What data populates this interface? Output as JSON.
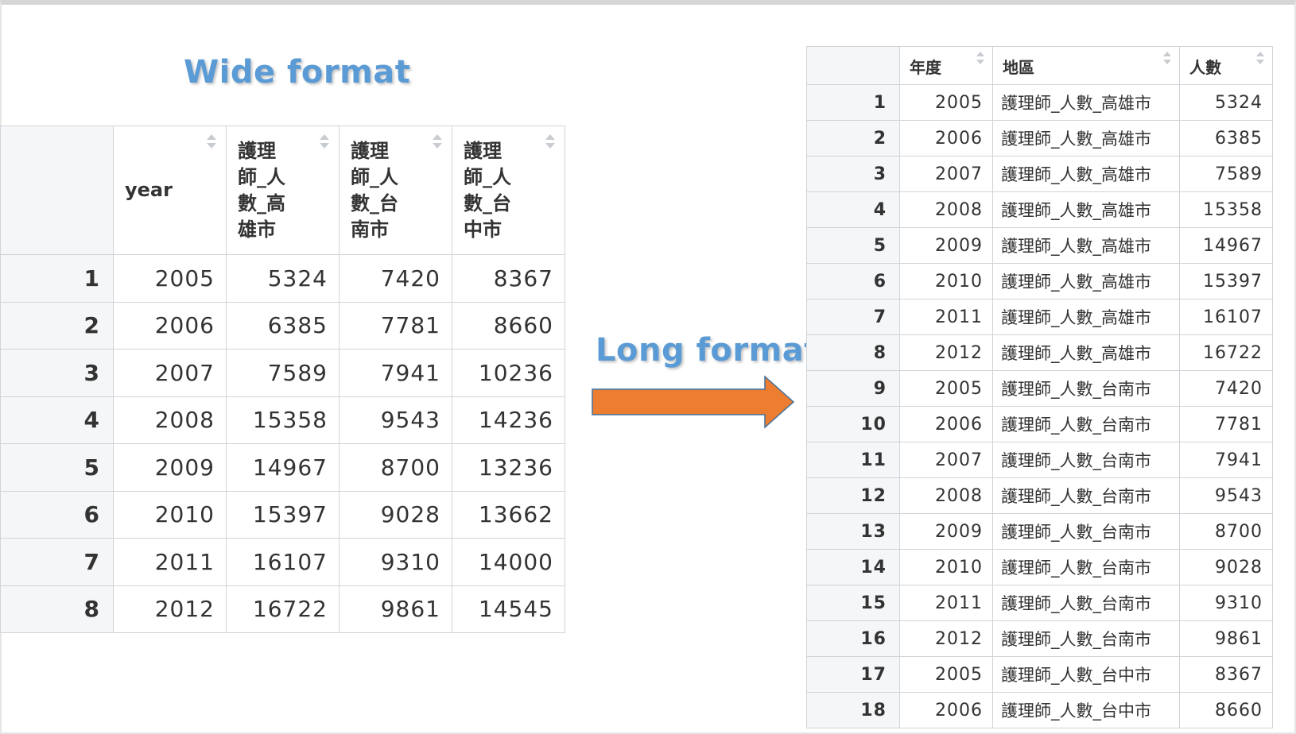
{
  "wide": {
    "title": "Wide format",
    "headers": [
      "year",
      "護理\n師_人\n數_高\n雄市",
      "護理\n師_人\n數_台\n南市",
      "護理\n師_人\n數_台\n中市"
    ],
    "rows": [
      {
        "index": "1",
        "values": [
          "2005",
          "5324",
          "7420",
          "8367"
        ]
      },
      {
        "index": "2",
        "values": [
          "2006",
          "6385",
          "7781",
          "8660"
        ]
      },
      {
        "index": "3",
        "values": [
          "2007",
          "7589",
          "7941",
          "10236"
        ]
      },
      {
        "index": "4",
        "values": [
          "2008",
          "15358",
          "9543",
          "14236"
        ]
      },
      {
        "index": "5",
        "values": [
          "2009",
          "14967",
          "8700",
          "13236"
        ]
      },
      {
        "index": "6",
        "values": [
          "2010",
          "15397",
          "9028",
          "13662"
        ]
      },
      {
        "index": "7",
        "values": [
          "2011",
          "16107",
          "9310",
          "14000"
        ]
      },
      {
        "index": "8",
        "values": [
          "2012",
          "16722",
          "9861",
          "14545"
        ]
      }
    ]
  },
  "long": {
    "title": "Long format",
    "headers": [
      "年度",
      "地區",
      "人數"
    ],
    "rows": [
      {
        "index": "1",
        "year": "2005",
        "region": "護理師_人數_高雄市",
        "count": "5324"
      },
      {
        "index": "2",
        "year": "2006",
        "region": "護理師_人數_高雄市",
        "count": "6385"
      },
      {
        "index": "3",
        "year": "2007",
        "region": "護理師_人數_高雄市",
        "count": "7589"
      },
      {
        "index": "4",
        "year": "2008",
        "region": "護理師_人數_高雄市",
        "count": "15358"
      },
      {
        "index": "5",
        "year": "2009",
        "region": "護理師_人數_高雄市",
        "count": "14967"
      },
      {
        "index": "6",
        "year": "2010",
        "region": "護理師_人數_高雄市",
        "count": "15397"
      },
      {
        "index": "7",
        "year": "2011",
        "region": "護理師_人數_高雄市",
        "count": "16107"
      },
      {
        "index": "8",
        "year": "2012",
        "region": "護理師_人數_高雄市",
        "count": "16722"
      },
      {
        "index": "9",
        "year": "2005",
        "region": "護理師_人數_台南市",
        "count": "7420"
      },
      {
        "index": "10",
        "year": "2006",
        "region": "護理師_人數_台南市",
        "count": "7781"
      },
      {
        "index": "11",
        "year": "2007",
        "region": "護理師_人數_台南市",
        "count": "7941"
      },
      {
        "index": "12",
        "year": "2008",
        "region": "護理師_人數_台南市",
        "count": "9543"
      },
      {
        "index": "13",
        "year": "2009",
        "region": "護理師_人數_台南市",
        "count": "8700"
      },
      {
        "index": "14",
        "year": "2010",
        "region": "護理師_人數_台南市",
        "count": "9028"
      },
      {
        "index": "15",
        "year": "2011",
        "region": "護理師_人數_台南市",
        "count": "9310"
      },
      {
        "index": "16",
        "year": "2012",
        "region": "護理師_人數_台南市",
        "count": "9861"
      },
      {
        "index": "17",
        "year": "2005",
        "region": "護理師_人數_台中市",
        "count": "8367"
      },
      {
        "index": "18",
        "year": "2006",
        "region": "護理師_人數_台中市",
        "count": "8660"
      }
    ]
  },
  "colors": {
    "title": "#5b9bd5",
    "arrow_fill": "#ed7d31",
    "arrow_stroke": "#41719c",
    "index_column_bg": "#f4f6f8",
    "grid": "#d0d4d8"
  },
  "icons": {
    "sort": "sort-arrows-icon",
    "transform_arrow": "right-arrow-icon"
  }
}
